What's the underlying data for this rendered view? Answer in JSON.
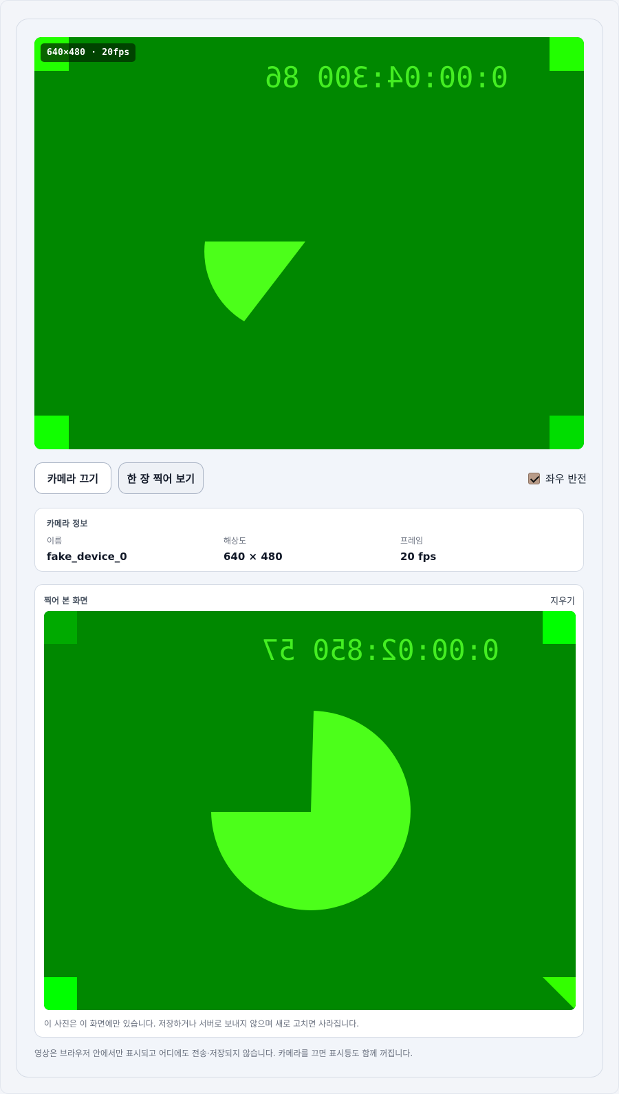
{
  "preview": {
    "badge": "640×480 · 20fps",
    "timecode": "0:00:04:300 86",
    "colors": {
      "background": "#008800",
      "shape": "#4cff1a",
      "corner_tl": "#22ff00",
      "corner_tr": "#22ff00",
      "corner_bl": "#11ff00",
      "corner_br": "#00dd00",
      "timecode": "#44ee22"
    }
  },
  "controls": {
    "camera_off_label": "카메라 끄기",
    "snapshot_label": "한 장 찍어 보기",
    "mirror_label": "좌우 반전",
    "mirror_checked": true
  },
  "info": {
    "title": "카메라 정보",
    "name_label": "이름",
    "name_value": "fake_device_0",
    "resolution_label": "해상도",
    "resolution_value": "640 × 480",
    "frame_label": "프레임",
    "frame_value": "20 fps"
  },
  "snapshot": {
    "title": "찍어 본 화면",
    "clear_label": "지우기",
    "timecode": "0:00:02:850 57",
    "note": "이 사진은 이 화면에만 있습니다. 저장하거나 서버로 보내지 않으며 새로 고치면 사라집니다.",
    "colors": {
      "background": "#008800",
      "shape": "#4cff1a",
      "corner_tl": "#00aa00",
      "corner_tr": "#00ff00",
      "corner_bl": "#00ff00",
      "corner_br": "#33ff00",
      "timecode": "#44ee22"
    }
  },
  "footer": {
    "note": "영상은 브라우저 안에서만 표시되고 어디에도 전송·저장되지 않습니다. 카메라를 끄면 표시등도 함께 꺼집니다."
  }
}
